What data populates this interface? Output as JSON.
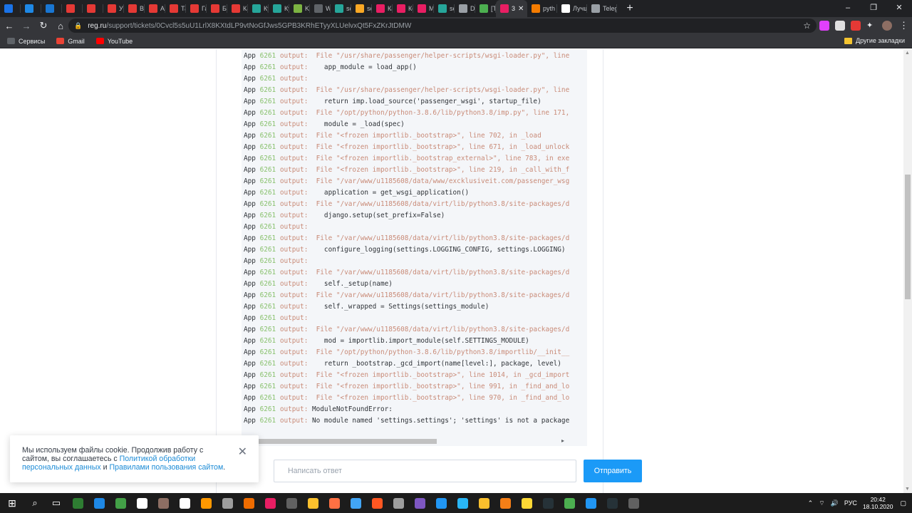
{
  "tabs": [
    {
      "title": "",
      "color": "#1a73e8"
    },
    {
      "title": "",
      "color": "#1e88e5"
    },
    {
      "title": "",
      "color": "#1976d2"
    },
    {
      "title": "",
      "color": "#e53935"
    },
    {
      "title": "",
      "color": "#e53935"
    },
    {
      "title": "Урок",
      "color": "#e53935"
    },
    {
      "title": "Ввод",
      "color": "#e53935"
    },
    {
      "title": "Алхи",
      "color": "#e53935"
    },
    {
      "title": "Табл",
      "color": "#e53935"
    },
    {
      "title": "Гайд",
      "color": "#e53935"
    },
    {
      "title": "Безо",
      "color": "#e53935"
    },
    {
      "title": "Как ,",
      "color": "#e53935"
    },
    {
      "title": "Курс",
      "color": "#26a69a"
    },
    {
      "title": "Курс",
      "color": "#26a69a"
    },
    {
      "title": "KIWI",
      "color": "#7cb342"
    },
    {
      "title": "We'r",
      "color": "#5f6368"
    },
    {
      "title": "serv",
      "color": "#26a69a"
    },
    {
      "title": "serv",
      "color": "#f9a825"
    },
    {
      "title": "Как ,",
      "color": "#e91e63"
    },
    {
      "title": "Корп",
      "color": "#e91e63"
    },
    {
      "title": "Мои",
      "color": "#e91e63"
    },
    {
      "title": "serv",
      "color": "#26a69a"
    },
    {
      "title": "Djan",
      "color": "#9aa0a6"
    },
    {
      "title": "[Tick",
      "color": "#4caf50"
    }
  ],
  "active_tab": {
    "title": "3",
    "color": "#e91e63"
  },
  "tabs_after": [
    {
      "title": "pyth",
      "color": "#f57c00"
    },
    {
      "title": "Лучш",
      "color": "#ffffff"
    },
    {
      "title": "Teleg",
      "color": "#9aa0a6"
    }
  ],
  "window_controls": {
    "minimize": "–",
    "maximize": "❐",
    "close": "✕"
  },
  "url": {
    "host": "reg.ru",
    "path": "/support/tickets/0Cvcl5s5uU1LrlX8KXtdLP9vtNoGfJws5GPB3KRhETyyXLUelvxQt5FxZKrJtDMW"
  },
  "bookmarks": [
    {
      "label": "Сервисы",
      "color": "#5f6368"
    },
    {
      "label": "Gmail",
      "color": "#ea4335"
    },
    {
      "label": "YouTube",
      "color": "#ff0000"
    }
  ],
  "other_bookmarks": "Другие закладки",
  "log": {
    "app": "App",
    "pid": "6261",
    "label": "output:",
    "lines": [
      "  File \"/usr/share/passenger/helper-scripts/wsgi-loader.py\", line",
      "    app_module = load_app()",
      "",
      "  File \"/usr/share/passenger/helper-scripts/wsgi-loader.py\", line",
      "    return imp.load_source('passenger_wsgi', startup_file)",
      "  File \"/opt/python/python-3.8.6/lib/python3.8/imp.py\", line 171,",
      "    module = _load(spec)",
      "  File \"<frozen importlib._bootstrap>\", line 702, in _load",
      "  File \"<frozen importlib._bootstrap>\", line 671, in _load_unlock",
      "  File \"<frozen importlib._bootstrap_external>\", line 783, in exe",
      "  File \"<frozen importlib._bootstrap>\", line 219, in _call_with_f",
      "  File \"/var/www/u1185608/data/www/excklusiveit.com/passenger_wsg",
      "    application = get_wsgi_application()",
      "  File \"/var/www/u1185608/data/virt/lib/python3.8/site-packages/d",
      "    django.setup(set_prefix=False)",
      "",
      "  File \"/var/www/u1185608/data/virt/lib/python3.8/site-packages/d",
      "    configure_logging(settings.LOGGING_CONFIG, settings.LOGGING)",
      "",
      "  File \"/var/www/u1185608/data/virt/lib/python3.8/site-packages/d",
      "    self._setup(name)",
      "  File \"/var/www/u1185608/data/virt/lib/python3.8/site-packages/d",
      "    self._wrapped = Settings(settings_module)",
      "",
      "  File \"/var/www/u1185608/data/virt/lib/python3.8/site-packages/d",
      "    mod = importlib.import_module(self.SETTINGS_MODULE)",
      "  File \"/opt/python/python-3.8.6/lib/python3.8/importlib/__init__",
      "    return _bootstrap._gcd_import(name[level:], package, level)",
      "  File \"<frozen importlib._bootstrap>\", line 1014, in _gcd_import",
      "  File \"<frozen importlib._bootstrap>\", line 991, in _find_and_lo",
      "  File \"<frozen importlib._bootstrap>\", line 970, in _find_and_lo",
      " ModuleNotFoundError:",
      " No module named 'settings.settings'; 'settings' is not a package"
    ]
  },
  "cookie": {
    "text1": "Мы используем файлы cookie. Продолжив работу с сайтом, вы соглашаетесь с ",
    "link1": "Политикой обработки персональных данных",
    "and": " и ",
    "link2": "Правилами пользования сайтом",
    "end": "."
  },
  "reply": {
    "placeholder": "Написать ответ",
    "send": "Отправить"
  },
  "taskbar": {
    "apps": [
      "#2e7d32",
      "#1e88e5",
      "#43a047",
      "#ffffff",
      "#8d6e63",
      "#ffffff",
      "#ff9800",
      "#9e9e9e",
      "#ef6c00",
      "#e91e63",
      "#616161",
      "#fbc02d",
      "#ff7043",
      "#42a5f5",
      "#ff5722",
      "#9e9e9e",
      "#7e57c2",
      "#2196f3",
      "#29b6f6",
      "#fbc02d",
      "#f57f17",
      "#fdd835",
      "#263238",
      "#4caf50",
      "#2196f3",
      "#263238",
      "#616161"
    ],
    "lang": "РУС",
    "time": "20:42",
    "date": "18.10.2020"
  }
}
